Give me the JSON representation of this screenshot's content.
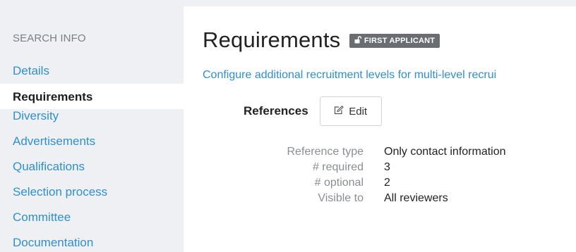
{
  "sidebar": {
    "heading": "SEARCH INFO",
    "items": [
      {
        "label": "Details"
      },
      {
        "label": "Requirements"
      },
      {
        "label": "Diversity"
      },
      {
        "label": "Advertisements"
      },
      {
        "label": "Qualifications"
      },
      {
        "label": "Selection process"
      },
      {
        "label": "Committee"
      },
      {
        "label": "Documentation"
      }
    ],
    "active_index": 1
  },
  "header": {
    "title": "Requirements",
    "badge": "FIRST APPLICANT",
    "badge_icon": "unlock-icon"
  },
  "main": {
    "intro_link": "Configure additional recruitment levels for multi-level recrui",
    "section": {
      "title": "References",
      "edit_label": "Edit",
      "edit_icon": "pencil-square-icon"
    },
    "details": [
      {
        "label": "Reference type",
        "value": "Only contact information"
      },
      {
        "label": "# required",
        "value": "3"
      },
      {
        "label": "# optional",
        "value": "2"
      },
      {
        "label": "Visible to",
        "value": "All reviewers"
      }
    ]
  },
  "colors": {
    "sidebar_bg": "#eef0f3",
    "link": "#2f8fcf",
    "badge_bg": "#6a6d71",
    "muted_text": "#8a8e93"
  }
}
